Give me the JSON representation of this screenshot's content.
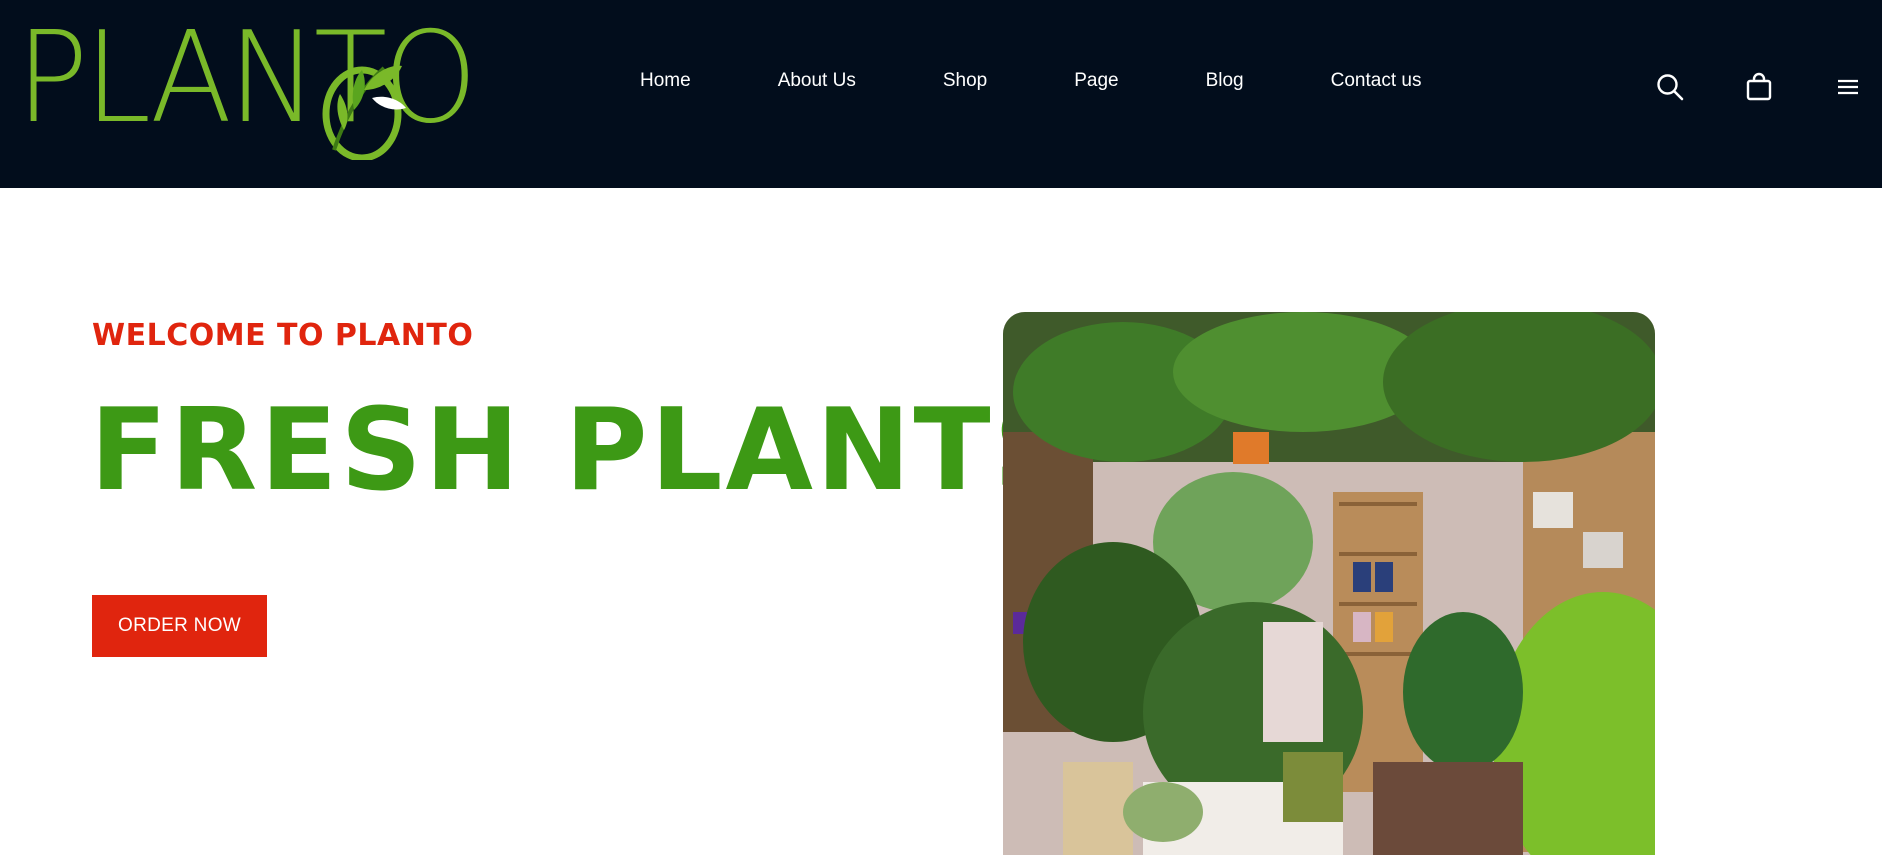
{
  "brand": {
    "logo_text": "PLANTO",
    "logo_color": "#7ab929"
  },
  "nav": {
    "items": [
      {
        "label": "Home"
      },
      {
        "label": "About Us"
      },
      {
        "label": "Shop"
      },
      {
        "label": "Page"
      },
      {
        "label": "Blog"
      },
      {
        "label": "Contact us"
      }
    ]
  },
  "header_icons": {
    "search": "search-icon",
    "cart": "shopping-bag-icon",
    "menu": "hamburger-menu-icon"
  },
  "hero": {
    "eyebrow": "WELCOME TO PLANTO",
    "headline": "FRESH PLANTS",
    "cta_label": "ORDER NOW",
    "image": "plant-shop-interior-photo"
  },
  "colors": {
    "header_bg": "#020d1c",
    "accent_red": "#e0250e",
    "headline_green": "#3d9915"
  }
}
